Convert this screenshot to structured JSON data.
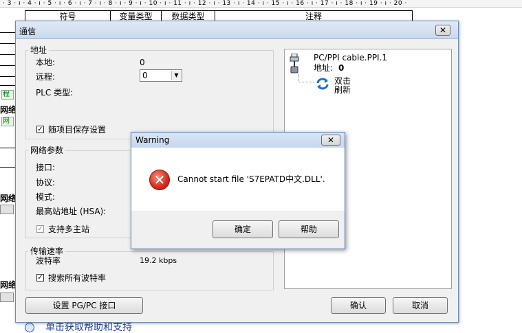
{
  "background": {
    "ruler_text": "· 3 · ı · 4 · ı · 5 · ı · 6 · ı · 7 · ı · 8 · ı · 9 · ı · 10 · ı · 11 · ı · 12 · ı · 13 · ı · 14 · ı · 15 · ı · 16 · ı · 17 · ı · 18 · ı · 19 · ı · 20 ·",
    "columns": [
      "符号",
      "变量类型",
      "数据类型",
      "注释"
    ],
    "side_labels": [
      "程",
      "网络",
      "网",
      "网络",
      "网络"
    ],
    "help_text": "单击获取帮助和支持"
  },
  "comm_dialog": {
    "title": "通信",
    "close_glyph": "✕",
    "address_group": {
      "legend": "地址",
      "local_label": "本地:",
      "local_value": "0",
      "remote_label": "远程:",
      "remote_value": "0",
      "plc_type_label": "PLC 类型:",
      "save_checkbox_label": "随项目保存设置"
    },
    "network_group": {
      "legend": "网络参数",
      "interface_label": "接口:",
      "protocol_label": "协议:",
      "mode_label": "模式:",
      "hsa_label": "最高站地址 (HSA):",
      "multimaster_label": "支持多主站"
    },
    "baud_group": {
      "legend": "传输速率",
      "baud_label": "波特率",
      "baud_value": "19.2 kbps",
      "search_all_label": "搜索所有波特率"
    },
    "tree": {
      "cable_label": "PC/PPI cable.PPI.1",
      "address_label": "地址:",
      "address_value": "0",
      "refresh_line1": "双击",
      "refresh_line2": "刷新"
    },
    "set_pgpc_button": "设置 PG/PC 接口",
    "ok_button": "确认",
    "cancel_button": "取消"
  },
  "warning_dialog": {
    "title": "Warning",
    "close_glyph": "✕",
    "message": "Cannot start file 'S7EPATD中文.DLL'.",
    "confirm_button": "确定",
    "help_button": "帮助"
  },
  "colors": {
    "title_bar": "#c9d9ee",
    "error_red": "#d12b1e",
    "refresh_blue": "#1f6fd0"
  }
}
